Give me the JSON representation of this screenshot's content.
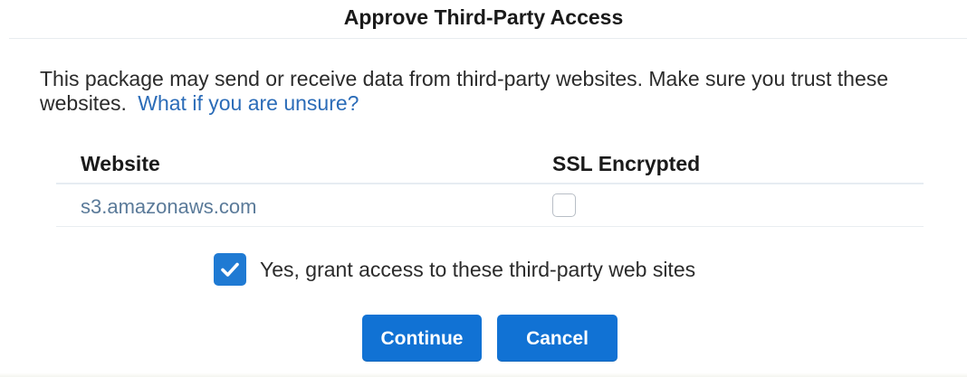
{
  "dialog": {
    "title": "Approve Third-Party Access",
    "message": "This package may send or receive data from third-party websites. Make sure you trust these websites.",
    "help_link": "What if you are unsure?"
  },
  "table": {
    "headers": {
      "website": "Website",
      "ssl": "SSL Encrypted"
    },
    "rows": [
      {
        "website": "s3.amazonaws.com",
        "ssl_encrypted": false
      }
    ]
  },
  "grant": {
    "label": "Yes, grant access to these third-party web sites",
    "checked": true
  },
  "buttons": {
    "continue": "Continue",
    "cancel": "Cancel"
  },
  "colors": {
    "accent": "#1172d4",
    "link": "#2b6cb8",
    "website_text": "#5a7a99"
  },
  "icons": {
    "grant_checkbox": "checkmark-icon"
  }
}
